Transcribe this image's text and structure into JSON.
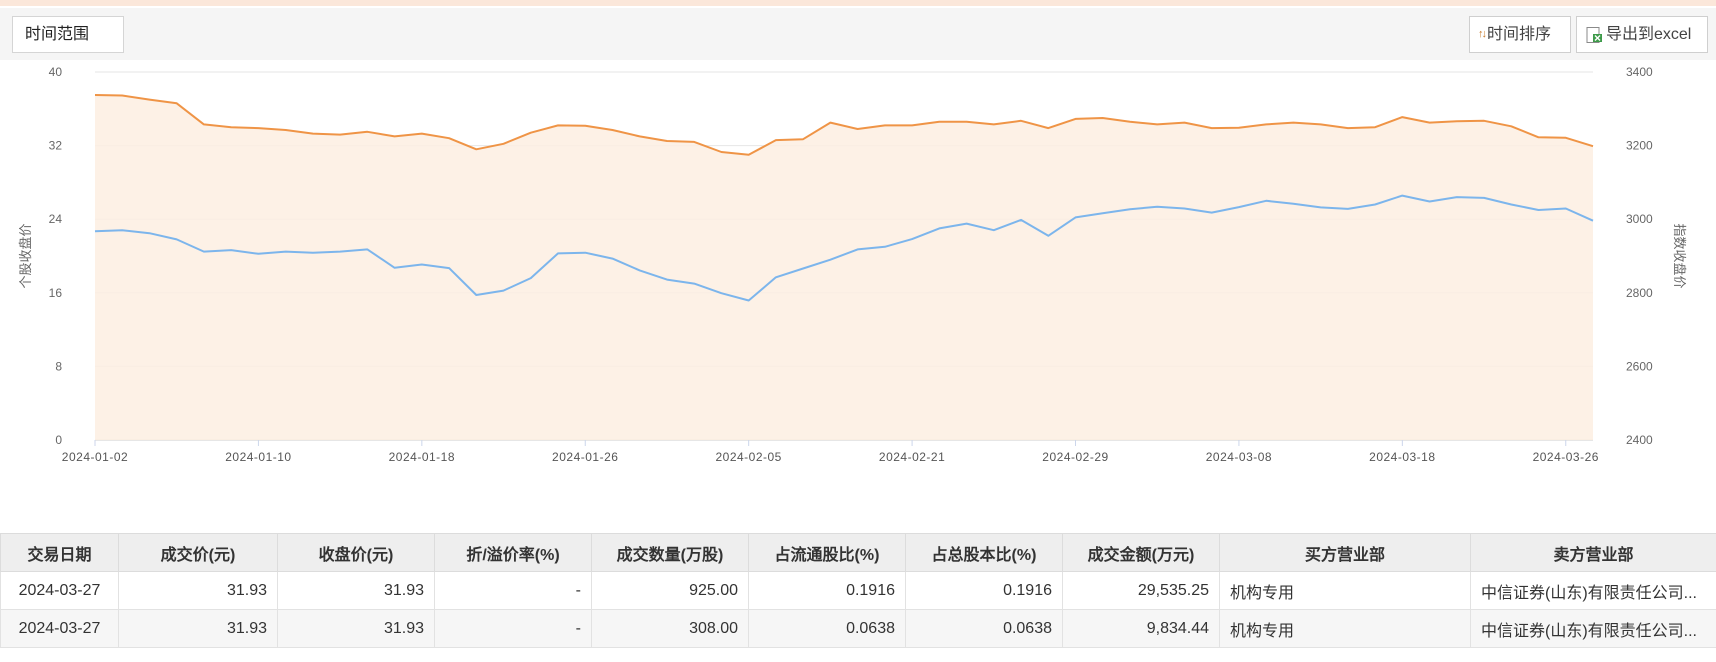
{
  "toolbar": {
    "time_range_label": "时间范围",
    "sort_label": "时间排序",
    "export_label": "导出到excel"
  },
  "chart_data": {
    "type": "line",
    "x_ticks": [
      "2024-01-02",
      "2024-01-10",
      "2024-01-18",
      "2024-01-26",
      "2024-02-05",
      "2024-02-21",
      "2024-02-29",
      "2024-03-08",
      "2024-03-18",
      "2024-03-26"
    ],
    "left_axis": {
      "label": "个股收盘价",
      "ticks": [
        0,
        8,
        16,
        24,
        32,
        40
      ],
      "ylim": [
        0,
        40
      ]
    },
    "right_axis": {
      "label": "指数收盘价",
      "ticks": [
        2400,
        2600,
        2800,
        3000,
        3200,
        3400
      ],
      "ylim": [
        2400,
        3400
      ]
    },
    "series": [
      {
        "name": "指数收盘价",
        "axis": "right",
        "color": "#7cb5ec",
        "values": [
          2967,
          2970,
          2962,
          2945,
          2912,
          2916,
          2906,
          2912,
          2909,
          2912,
          2918,
          2868,
          2877,
          2867,
          2794,
          2806,
          2840,
          2907,
          2909,
          2893,
          2861,
          2836,
          2825,
          2799,
          2779,
          2842,
          2866,
          2890,
          2918,
          2925,
          2946,
          2975,
          2988,
          2970,
          2998,
          2955,
          3005,
          3016,
          3027,
          3034,
          3029,
          3018,
          3033,
          3050,
          3042,
          3032,
          3028,
          3040,
          3064,
          3048,
          3060,
          3058,
          3040,
          3025,
          3029,
          2996
        ]
      },
      {
        "name": "个股收盘价",
        "axis": "left",
        "color": "#ef9446",
        "area": true,
        "values": [
          37.5,
          37.45,
          37.0,
          36.6,
          34.3,
          34.0,
          33.9,
          33.7,
          33.3,
          33.2,
          33.5,
          33.0,
          33.3,
          32.8,
          31.6,
          32.2,
          33.4,
          34.2,
          34.15,
          33.7,
          33.0,
          32.5,
          32.4,
          31.3,
          31.0,
          32.6,
          32.7,
          34.5,
          33.8,
          34.2,
          34.2,
          34.6,
          34.6,
          34.3,
          34.7,
          33.9,
          34.9,
          35.0,
          34.6,
          34.3,
          34.5,
          33.9,
          33.95,
          34.3,
          34.5,
          34.3,
          33.9,
          34.0,
          35.1,
          34.5,
          34.65,
          34.7,
          34.1,
          32.9,
          32.85,
          31.93
        ]
      }
    ],
    "legend": [
      "指数收盘价",
      "个股收盘价"
    ],
    "legend_position": "bottom-center",
    "grid": true
  },
  "table": {
    "headers": [
      "交易日期",
      "成交价(元)",
      "收盘价(元)",
      "折/溢价率(%)",
      "成交数量(万股)",
      "占流通股比(%)",
      "占总股本比(%)",
      "成交金额(万元)",
      "买方营业部",
      "卖方营业部"
    ],
    "rows": [
      [
        "2024-03-27",
        "31.93",
        "31.93",
        "-",
        "925.00",
        "0.1916",
        "0.1916",
        "29,535.25",
        "机构专用",
        "中信证券(山东)有限责任公司..."
      ],
      [
        "2024-03-27",
        "31.93",
        "31.93",
        "-",
        "308.00",
        "0.0638",
        "0.0638",
        "9,834.44",
        "机构专用",
        "中信证券(山东)有限责任公司..."
      ]
    ]
  }
}
